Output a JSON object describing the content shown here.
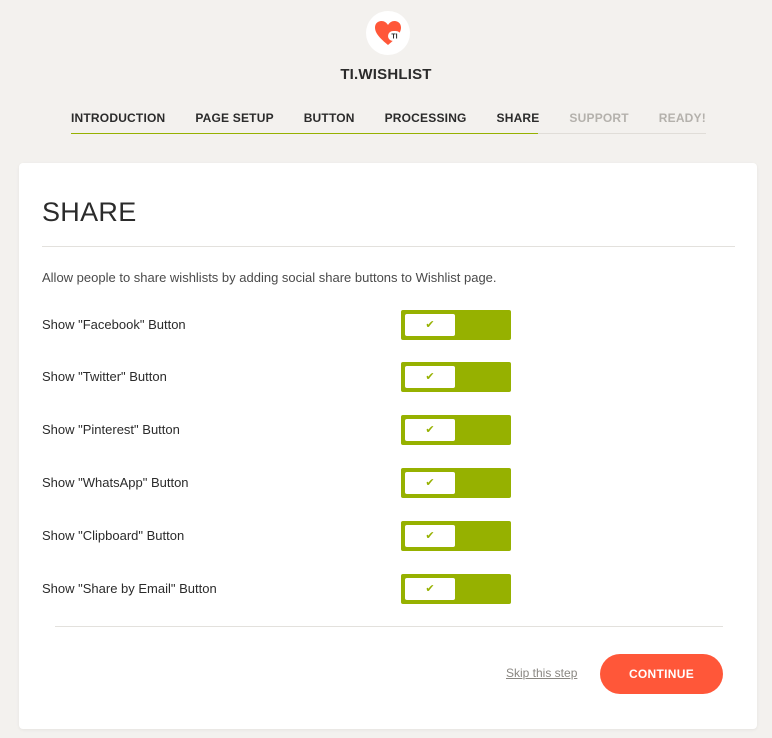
{
  "brand": {
    "name": "TI.WISHLIST",
    "logo_badge": "TI",
    "logo_color": "#ff5739"
  },
  "steps": [
    {
      "label": "INTRODUCTION",
      "state": "done"
    },
    {
      "label": "PAGE SETUP",
      "state": "done"
    },
    {
      "label": "BUTTON",
      "state": "done"
    },
    {
      "label": "PROCESSING",
      "state": "done"
    },
    {
      "label": "SHARE",
      "state": "current"
    },
    {
      "label": "SUPPORT",
      "state": "pending"
    },
    {
      "label": "READY!",
      "state": "pending"
    }
  ],
  "card": {
    "title": "SHARE",
    "intro": "Allow people to share wishlists by adding social share buttons to Wishlist page."
  },
  "options": [
    {
      "label": "Show \"Facebook\" Button",
      "enabled": true,
      "icon": "check-icon"
    },
    {
      "label": "Show \"Twitter\" Button",
      "enabled": true,
      "icon": "check-icon"
    },
    {
      "label": "Show \"Pinterest\" Button",
      "enabled": true,
      "icon": "check-icon"
    },
    {
      "label": "Show \"WhatsApp\" Button",
      "enabled": true,
      "icon": "check-icon"
    },
    {
      "label": "Show \"Clipboard\" Button",
      "enabled": true,
      "icon": "check-icon"
    },
    {
      "label": "Show \"Share by Email\" Button",
      "enabled": true,
      "icon": "check-icon"
    }
  ],
  "actions": {
    "skip_label": "Skip this step",
    "continue_label": "CONTINUE"
  },
  "colors": {
    "accent_green": "#96b100",
    "accent_orange": "#ff5739",
    "background": "#f3f1ee"
  }
}
